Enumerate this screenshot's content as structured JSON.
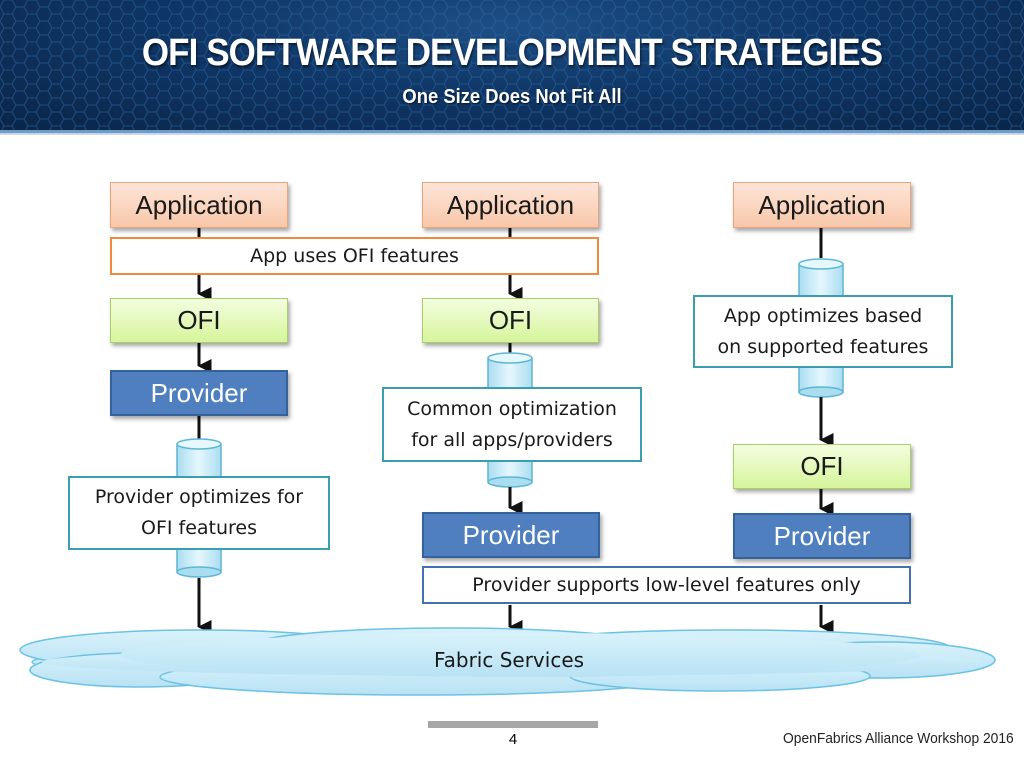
{
  "header": {
    "title": "OFI SOFTWARE DEVELOPMENT STRATEGIES",
    "subtitle": "One Size Does Not Fit All"
  },
  "columns": [
    {
      "application": "Application",
      "ofi": "OFI",
      "provider": "Provider",
      "note_line1": "Provider optimizes for",
      "note_line2": "OFI features"
    },
    {
      "application": "Application",
      "ofi": "OFI",
      "provider": "Provider",
      "note_line1": "Common optimization",
      "note_line2": "for all apps/providers"
    },
    {
      "application": "Application",
      "ofi": "OFI",
      "provider": "Provider",
      "note_line1": "App optimizes based",
      "note_line2": "on supported features"
    }
  ],
  "shared_notes": {
    "app_uses": "App uses OFI features",
    "provider_supports": "Provider supports low-level features only"
  },
  "fabric": "Fabric Services",
  "footer": {
    "page_number": "4",
    "event": "OpenFabrics Alliance Workshop 2016"
  },
  "colors": {
    "header_bg": "#0f3666",
    "application_fill": "#f8c7a9",
    "ofi_fill": "#d6f59a",
    "provider_fill": "#4f7fbf",
    "note_border_teal": "#3a9db0",
    "note_border_orange": "#ef8a3c",
    "cloud_fill": "#c7e9f7"
  }
}
